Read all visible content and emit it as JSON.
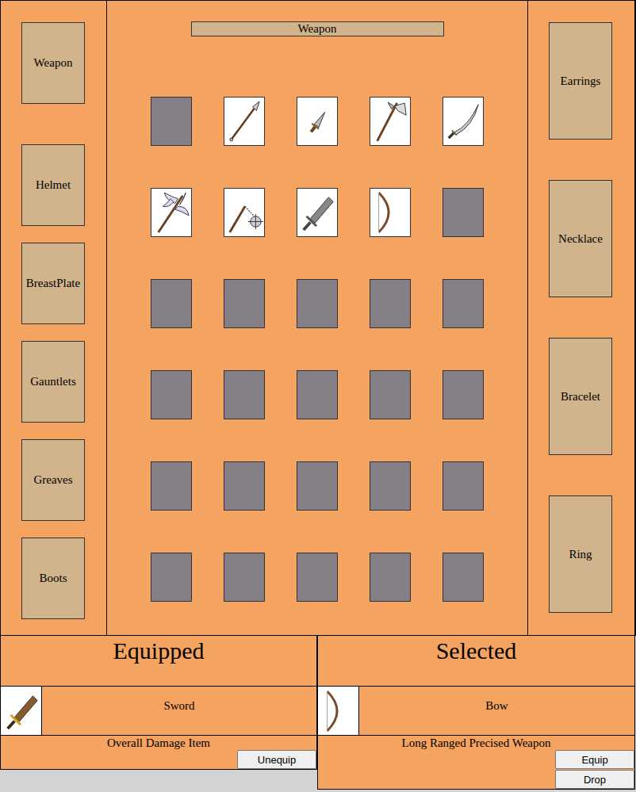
{
  "equipment_slots": {
    "left": [
      {
        "label": "Weapon"
      },
      {
        "label": "Helmet"
      },
      {
        "label": "BreastPlate"
      },
      {
        "label": "Gauntlets"
      },
      {
        "label": "Greaves"
      },
      {
        "label": "Boots"
      }
    ],
    "right": [
      {
        "label": "Earrings"
      },
      {
        "label": "Necklace"
      },
      {
        "label": "Bracelet"
      },
      {
        "label": "Ring"
      }
    ]
  },
  "category": {
    "title": "Weapon"
  },
  "inventory": [
    {
      "kind": "empty"
    },
    {
      "kind": "spear"
    },
    {
      "kind": "dagger"
    },
    {
      "kind": "axe"
    },
    {
      "kind": "scimitar"
    },
    {
      "kind": "battleaxe"
    },
    {
      "kind": "flail"
    },
    {
      "kind": "sword"
    },
    {
      "kind": "bow"
    },
    {
      "kind": "empty"
    },
    {
      "kind": "empty"
    },
    {
      "kind": "empty"
    },
    {
      "kind": "empty"
    },
    {
      "kind": "empty"
    },
    {
      "kind": "empty"
    },
    {
      "kind": "empty"
    },
    {
      "kind": "empty"
    },
    {
      "kind": "empty"
    },
    {
      "kind": "empty"
    },
    {
      "kind": "empty"
    },
    {
      "kind": "empty"
    },
    {
      "kind": "empty"
    },
    {
      "kind": "empty"
    },
    {
      "kind": "empty"
    },
    {
      "kind": "empty"
    },
    {
      "kind": "empty"
    },
    {
      "kind": "empty"
    },
    {
      "kind": "empty"
    },
    {
      "kind": "empty"
    },
    {
      "kind": "empty"
    }
  ],
  "equipped": {
    "title": "Equipped",
    "item": {
      "name": "Sword",
      "description": "Overall Damage Item",
      "kind": "sword"
    },
    "buttons": [
      "Unequip"
    ]
  },
  "selected": {
    "title": "Selected",
    "item": {
      "name": "Bow",
      "description": "Long Ranged Precised Weapon",
      "kind": "bow"
    },
    "buttons": [
      "Equip",
      "Drop"
    ]
  }
}
